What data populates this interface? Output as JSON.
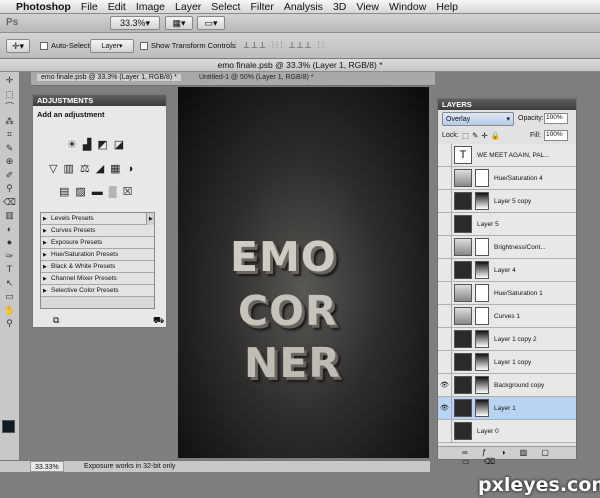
{
  "menubar": {
    "app": "Photoshop",
    "items": [
      "File",
      "Edit",
      "Image",
      "Layer",
      "Select",
      "Filter",
      "Analysis",
      "3D",
      "View",
      "Window",
      "Help"
    ]
  },
  "appbar": {
    "logo": "Ps",
    "zoom": "33.3%"
  },
  "options": {
    "auto_select_label": "Auto-Select:",
    "auto_select_value": "Layer",
    "show_transform": "Show Transform Controls"
  },
  "document": {
    "title": "emo finale.psb @ 33.3% (Layer 1, RGB/8) *",
    "tabs": [
      "emo finale.psb @ 33.3% (Layer 1, RGB/8) *",
      "Untitled-1 @ 50% (Layer 1, RGB/8) *"
    ]
  },
  "adjustments": {
    "header": "ADJUSTMENTS",
    "title": "Add an adjustment",
    "presets": [
      "Levels Presets",
      "Curves Presets",
      "Exposure Presets",
      "Hue/Saturation Presets",
      "Black & White Presets",
      "Channel Mixer Presets",
      "Selective Color Presets"
    ]
  },
  "artwork": {
    "lines": [
      "EMO",
      "COR",
      "NER"
    ]
  },
  "layers": {
    "header": "LAYERS",
    "blend_mode": "Overlay",
    "opacity_label": "Opacity:",
    "opacity": "100%",
    "lock_label": "Lock:",
    "fill_label": "Fill:",
    "fill": "100%",
    "items": [
      {
        "name": "WE MEET AGAIN, PAL...",
        "visible": false,
        "type": "text"
      },
      {
        "name": "Hue/Saturation 4",
        "visible": false,
        "type": "adj"
      },
      {
        "name": "Layer 5 copy",
        "visible": false,
        "type": "mask"
      },
      {
        "name": "Layer 5",
        "visible": false,
        "type": "plain"
      },
      {
        "name": "Brightness/Cont...",
        "visible": false,
        "type": "adj"
      },
      {
        "name": "Layer 4",
        "visible": false,
        "type": "mask"
      },
      {
        "name": "Hue/Saturation 1",
        "visible": false,
        "type": "adj"
      },
      {
        "name": "Curves 1",
        "visible": false,
        "type": "adj"
      },
      {
        "name": "Layer 1 copy 2",
        "visible": false,
        "type": "mask"
      },
      {
        "name": "Layer 1 copy",
        "visible": false,
        "type": "mask"
      },
      {
        "name": "Background copy",
        "visible": true,
        "type": "mask"
      },
      {
        "name": "Layer 1",
        "visible": true,
        "type": "mask",
        "selected": true
      },
      {
        "name": "Layer 0",
        "visible": false,
        "type": "plain"
      }
    ]
  },
  "status": {
    "zoom": "33.33%",
    "message": "Exposure works in 32-bit only"
  },
  "watermark": "pxleyes.com",
  "colors": {
    "selected_layer": "#b9d4f3",
    "panel_header": "#4a4a4a"
  }
}
